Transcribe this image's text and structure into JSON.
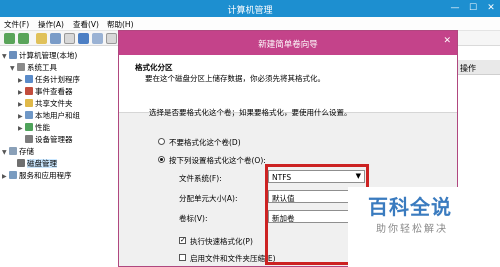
{
  "main_window": {
    "title": "计算机管理",
    "controls": {
      "minimize": "—",
      "maximize": "☐",
      "close": "✕"
    }
  },
  "menu": [
    "文件(F)",
    "操作(A)",
    "查看(V)",
    "帮助(H)"
  ],
  "tree": {
    "root": "计算机管理(本地)",
    "system_tools": "系统工具",
    "task_scheduler": "任务计划程序",
    "event_viewer": "事件查看器",
    "shared_folders": "共享文件夹",
    "local_users": "本地用户和组",
    "performance": "性能",
    "device_manager": "设备管理器",
    "storage": "存储",
    "disk_management": "磁盘管理",
    "services": "服务和应用程序"
  },
  "right_pane": {
    "header": "操作"
  },
  "wizard": {
    "title": "新建简单卷向导",
    "close": "✕",
    "section_title": "格式化分区",
    "section_desc": "要在这个磁盘分区上储存数据，你必须先将其格式化。",
    "prompt": "选择是否要格式化这个卷；如果要格式化，要使用什么设置。",
    "radio_no_format": "不要格式化这个卷(D)",
    "radio_format": "按下列设置格式化这个卷(O):",
    "fs_label": "文件系统(F):",
    "fs_value": "NTFS",
    "alloc_label": "分配单元大小(A):",
    "alloc_value": "默认值",
    "volume_label": "卷标(V):",
    "volume_value": "新加卷",
    "quick_format": "执行快速格式化(P)",
    "compression": "启用文件和文件夹压缩(E)"
  },
  "watermark": {
    "brand": "百科全说",
    "slogan": "助你轻松解决"
  },
  "colors": {
    "main_title": "#1d8fd0",
    "wizard_title": "#c4438a",
    "highlight": "#cc2222",
    "watermark": "#3a7bbf"
  }
}
